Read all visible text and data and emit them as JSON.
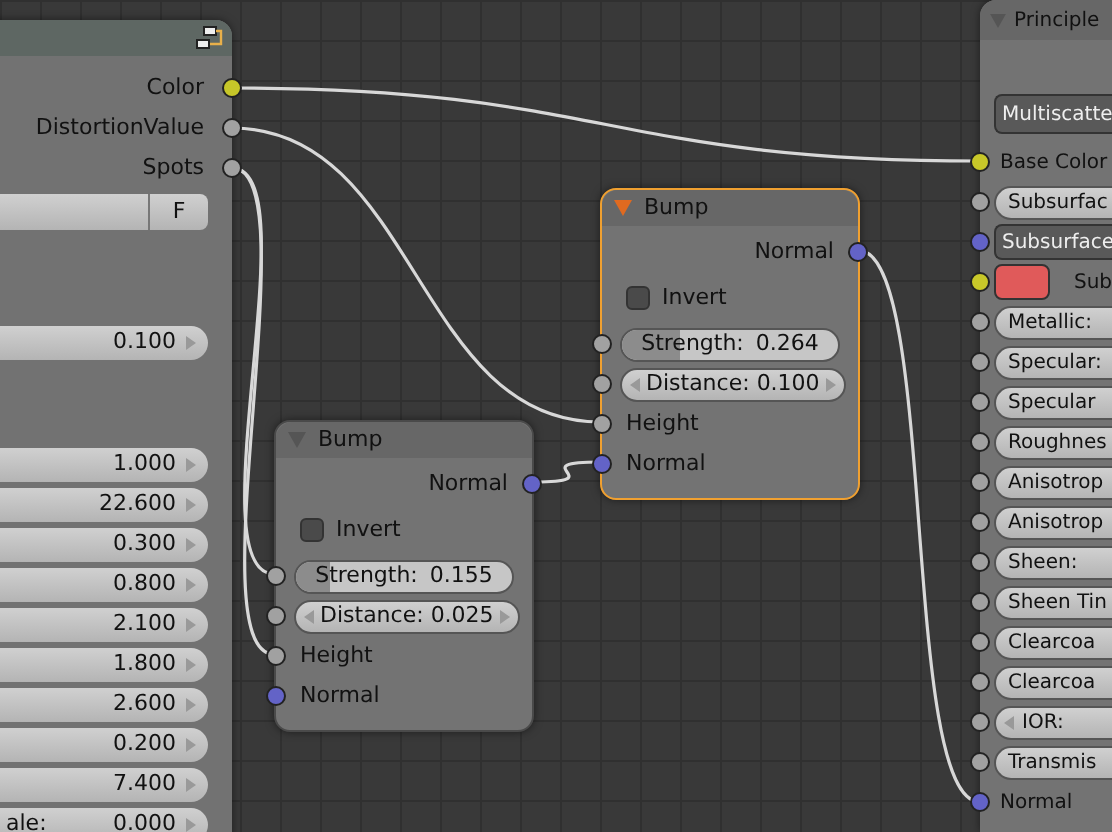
{
  "left_node": {
    "outputs": [
      {
        "label": "Color",
        "color": "#c7c729"
      },
      {
        "label": "DistortionValue",
        "color": "#a1a1a1"
      },
      {
        "label": "Spots",
        "color": "#a1a1a1"
      }
    ],
    "fake_user_button": "F",
    "value_field": "0.100",
    "values": [
      {
        "value": "1.000"
      },
      {
        "value": "22.600"
      },
      {
        "value": "0.300"
      },
      {
        "value": "0.800"
      },
      {
        "value": "2.100"
      },
      {
        "value": "1.800"
      },
      {
        "value": "2.600"
      },
      {
        "value": "0.200"
      },
      {
        "value": "7.400"
      },
      {
        "label": "ale:",
        "value": "0.000"
      }
    ]
  },
  "bump_nodes": [
    {
      "title": "Bump",
      "selected": false,
      "outputs": [
        {
          "label": "Normal",
          "color": "#6363c7"
        }
      ],
      "invert": {
        "label": "Invert",
        "checked": false
      },
      "strength": {
        "label": "Strength:",
        "value": "0.155",
        "level": 0.155,
        "color": "#a1a1a1"
      },
      "distance": {
        "label": "Distance:",
        "value": "0.025",
        "color": "#a1a1a1"
      },
      "inputs": [
        {
          "label": "Height",
          "color": "#a1a1a1"
        },
        {
          "label": "Normal",
          "color": "#6363c7"
        }
      ]
    },
    {
      "title": "Bump",
      "selected": true,
      "outputs": [
        {
          "label": "Normal",
          "color": "#6363c7"
        }
      ],
      "invert": {
        "label": "Invert",
        "checked": false
      },
      "strength": {
        "label": "Strength:",
        "value": "0.264",
        "level": 0.264,
        "color": "#a1a1a1"
      },
      "distance": {
        "label": "Distance:",
        "value": "0.100",
        "color": "#a1a1a1"
      },
      "inputs": [
        {
          "label": "Height",
          "color": "#a1a1a1"
        },
        {
          "label": "Normal",
          "color": "#6363c7"
        }
      ]
    }
  ],
  "principled_node": {
    "title": "Principle",
    "dropdown": "Multiscatte",
    "rows": [
      {
        "kind": "socket",
        "label": "Base Color",
        "color": "#c7c729"
      },
      {
        "kind": "slider",
        "label": "Subsurfac",
        "color": "#a1a1a1"
      },
      {
        "kind": "vector",
        "label": "Subsurface",
        "color": "#6363c7"
      },
      {
        "kind": "color",
        "label": "Sub",
        "color": "#c7c729",
        "swatch": {
          "color": "#e05a5a"
        }
      },
      {
        "kind": "slider",
        "label": "Metallic:",
        "color": "#a1a1a1"
      },
      {
        "kind": "slider",
        "label": "Specular:",
        "color": "#a1a1a1"
      },
      {
        "kind": "slider",
        "label": "Specular",
        "color": "#a1a1a1"
      },
      {
        "kind": "slider",
        "label": "Roughnes",
        "color": "#a1a1a1"
      },
      {
        "kind": "slider",
        "label": "Anisotrop",
        "color": "#a1a1a1"
      },
      {
        "kind": "slider",
        "label": "Anisotrop",
        "color": "#a1a1a1"
      },
      {
        "kind": "slider",
        "label": "Sheen:",
        "color": "#a1a1a1"
      },
      {
        "kind": "slider",
        "label": "Sheen Tin",
        "color": "#a1a1a1"
      },
      {
        "kind": "slider",
        "label": "Clearcoa",
        "color": "#a1a1a1"
      },
      {
        "kind": "slider",
        "label": "Clearcoa",
        "color": "#a1a1a1"
      },
      {
        "kind": "number",
        "label": "IOR:",
        "color": "#a1a1a1"
      },
      {
        "kind": "slider",
        "label": "Transmis",
        "color": "#a1a1a1"
      },
      {
        "kind": "socket",
        "label": "Normal",
        "color": "#6363c7"
      }
    ]
  }
}
